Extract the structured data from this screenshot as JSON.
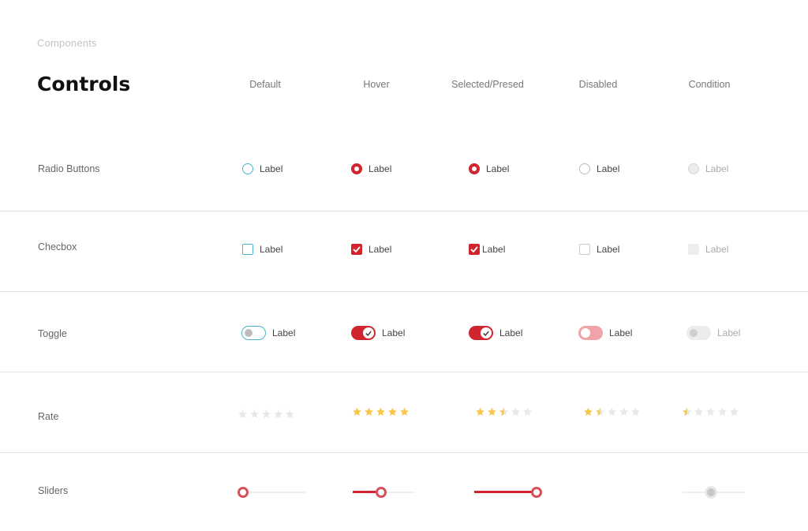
{
  "breadcrumb": "Components",
  "title": "Controls",
  "columns": [
    "Default",
    "Hover",
    "Selected/Presed",
    "Disabled",
    "Condition"
  ],
  "rows": {
    "radio": "Radio Buttons",
    "checkbox": "Checbox",
    "toggle": "Toggle",
    "rate": "Rate",
    "sliders": "Sliders"
  },
  "control_label": "Label",
  "ratings": {
    "default": 0,
    "hover": 5,
    "selected": 2.5,
    "disabled": 1.5,
    "condition": 0.5,
    "max": 5
  },
  "sliders": {
    "default": 0,
    "hover": 0.45,
    "selected": 1.0,
    "condition": 0.45
  },
  "colors": {
    "accent": "#d0252e",
    "focus": "#48b6d0",
    "star": "#f7c64a",
    "star_empty": "#e6e8ec"
  },
  "icons": {
    "check": "check-icon",
    "star": "star-icon"
  }
}
